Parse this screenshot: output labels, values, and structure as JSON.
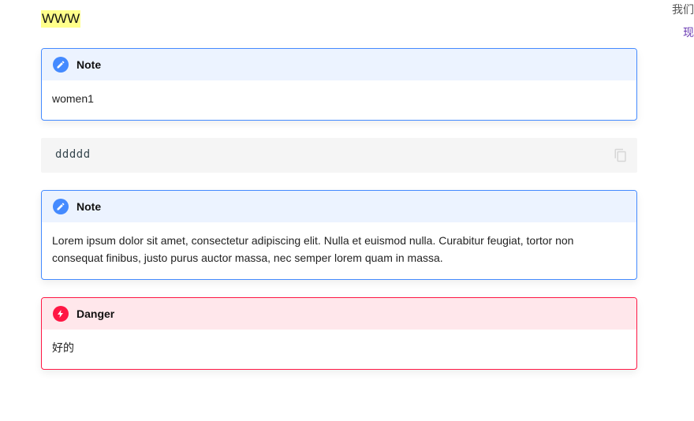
{
  "heading": "WWW",
  "toc": {
    "title": "我们",
    "link": "现"
  },
  "admonitions": [
    {
      "type": "note",
      "title": "Note",
      "icon": "pencil-icon",
      "body": "women1"
    },
    {
      "type": "note",
      "title": "Note",
      "icon": "pencil-icon",
      "body": "Lorem ipsum dolor sit amet, consectetur adipiscing elit. Nulla et euismod nulla. Curabitur feugiat, tortor non consequat finibus, justo purus auctor massa, nec semper lorem quam in massa."
    },
    {
      "type": "danger",
      "title": "Danger",
      "icon": "lightning-icon",
      "body": "好的"
    }
  ],
  "code": {
    "text": "ddddd",
    "copy_icon": "copy-icon"
  },
  "colors": {
    "note_accent": "#448aff",
    "danger_accent": "#ff1744",
    "highlight": "#ffff8a"
  }
}
